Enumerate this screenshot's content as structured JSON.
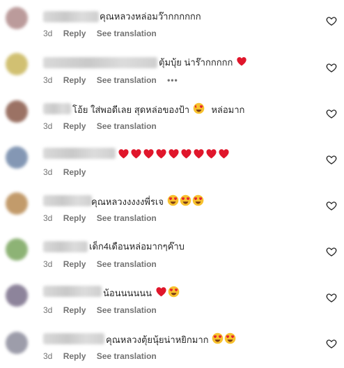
{
  "comments": [
    {
      "text": "คุณหลวงหล่อมว๊ากกกกกก",
      "emojis": [],
      "time": "3d",
      "reply": "Reply",
      "see_translation": "See translation",
      "more": "",
      "avatar_color": "#b08a8a"
    },
    {
      "text": "ตุ้มบุ้ย น่าร๊ากกกกก",
      "emojis": [
        "heart"
      ],
      "time": "3d",
      "reply": "Reply",
      "see_translation": "See translation",
      "more": "•••",
      "avatar_color": "#c9b65a"
    },
    {
      "text": "โอ้ย ใส่พอดีเลย สุดหล่อของป้า",
      "emojis": [
        "heart-eyes"
      ],
      "tail": "หล่อมาก",
      "time": "3d",
      "reply": "Reply",
      "see_translation": "See translation",
      "more": "",
      "avatar_color": "#8a5a4a"
    },
    {
      "text": "",
      "emojis": [
        "heart",
        "heart",
        "heart",
        "heart",
        "heart",
        "heart",
        "heart",
        "heart",
        "heart"
      ],
      "time": "3d",
      "reply": "Reply",
      "see_translation": "",
      "more": "",
      "avatar_color": "#6f86a8"
    },
    {
      "text": "คุณหลวงงงงงพี่รเจ",
      "emojis": [
        "heart-eyes",
        "heart-eyes",
        "heart-eyes"
      ],
      "time": "3d",
      "reply": "Reply",
      "see_translation": "See translation",
      "more": "",
      "avatar_color": "#b88a52"
    },
    {
      "text": "เด็ก4เดือนหล่อมากๆค๊าบ",
      "emojis": [],
      "time": "3d",
      "reply": "Reply",
      "see_translation": "See translation",
      "more": "",
      "avatar_color": "#7aa65e"
    },
    {
      "text": "น้อนนนนนน",
      "emojis": [
        "heart",
        "heart-eyes"
      ],
      "time": "3d",
      "reply": "Reply",
      "see_translation": "See translation",
      "more": "",
      "avatar_color": "#7a6f8a"
    },
    {
      "text": "คุณหลวงตุ้ยนุ้ยน่าหยิกมาก",
      "emojis": [
        "heart-eyes",
        "heart-eyes"
      ],
      "time": "3d",
      "reply": "Reply",
      "see_translation": "See translation",
      "more": "",
      "avatar_color": "#8c8c9c"
    }
  ],
  "icons": {
    "like": "heart-outline-icon"
  }
}
